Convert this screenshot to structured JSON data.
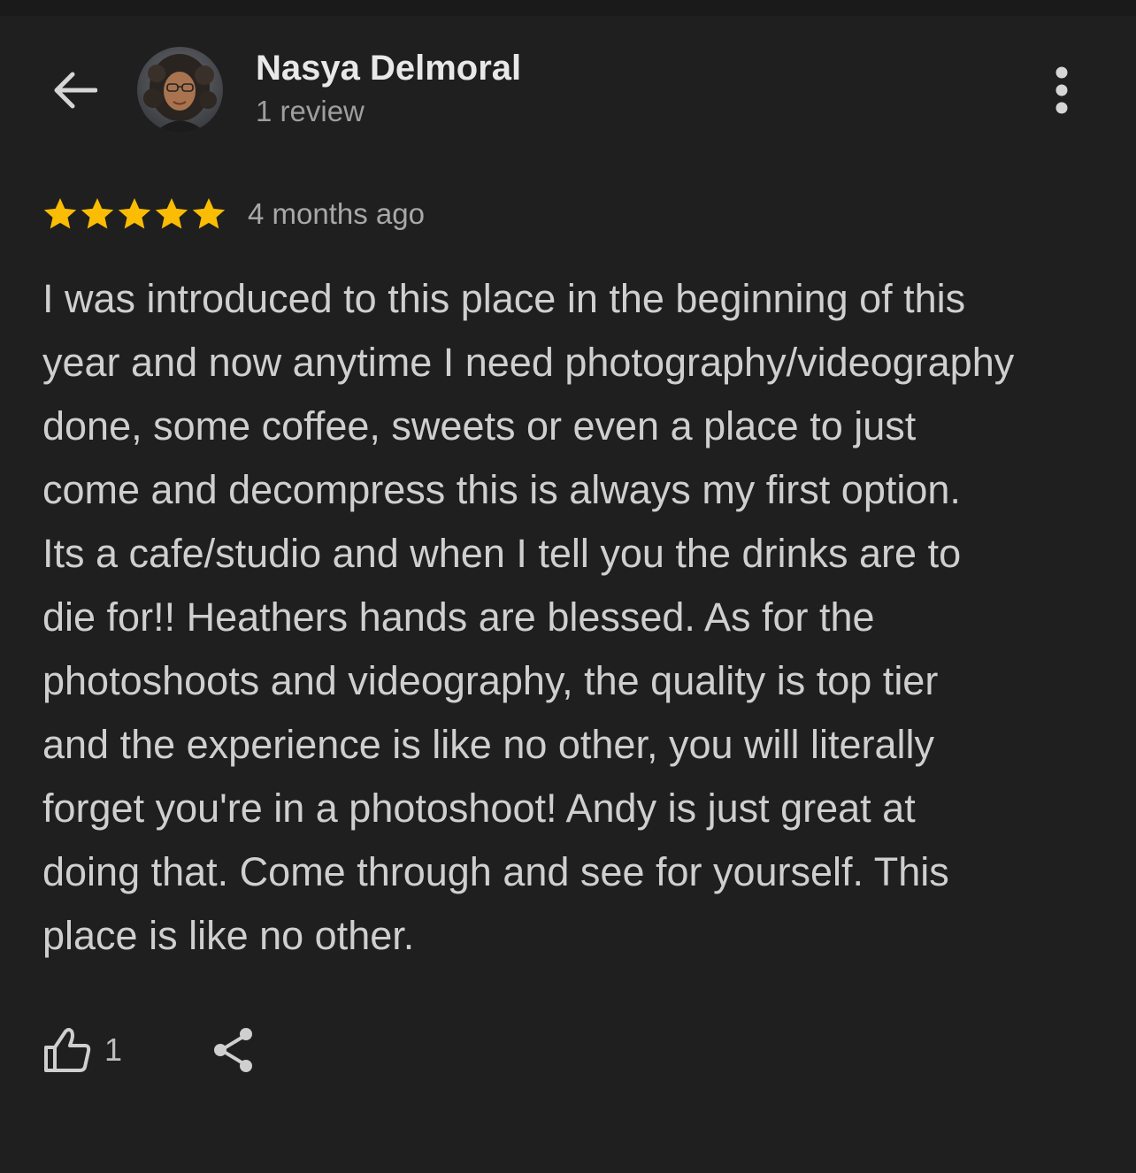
{
  "header": {
    "reviewer_name": "Nasya Delmoral",
    "review_count": "1 review",
    "back_icon": "arrow-left-icon",
    "more_icon": "more-vert-icon"
  },
  "review": {
    "rating": 5,
    "rating_max": 5,
    "star_color": "#fbbc04",
    "time_ago": "4 months ago",
    "text_lines": [
      "I was introduced to this place in the beginning of this",
      "year and now anytime I need photography/videography",
      "done, some coffee, sweets or even a place to just",
      "come and decompress this is always my first option.",
      "Its a cafe/studio and when I tell you the drinks are to",
      "die for!! Heathers hands are blessed. As for the",
      "photoshoots and videography, the quality is top tier",
      "and the experience is like no other, you will literally",
      "forget you're in a photoshoot! Andy is just great at",
      "doing that. Come through and see for yourself. This",
      "place is like no other."
    ]
  },
  "actions": {
    "like_count": "1",
    "like_icon": "thumb-up-icon",
    "share_icon": "share-icon"
  }
}
